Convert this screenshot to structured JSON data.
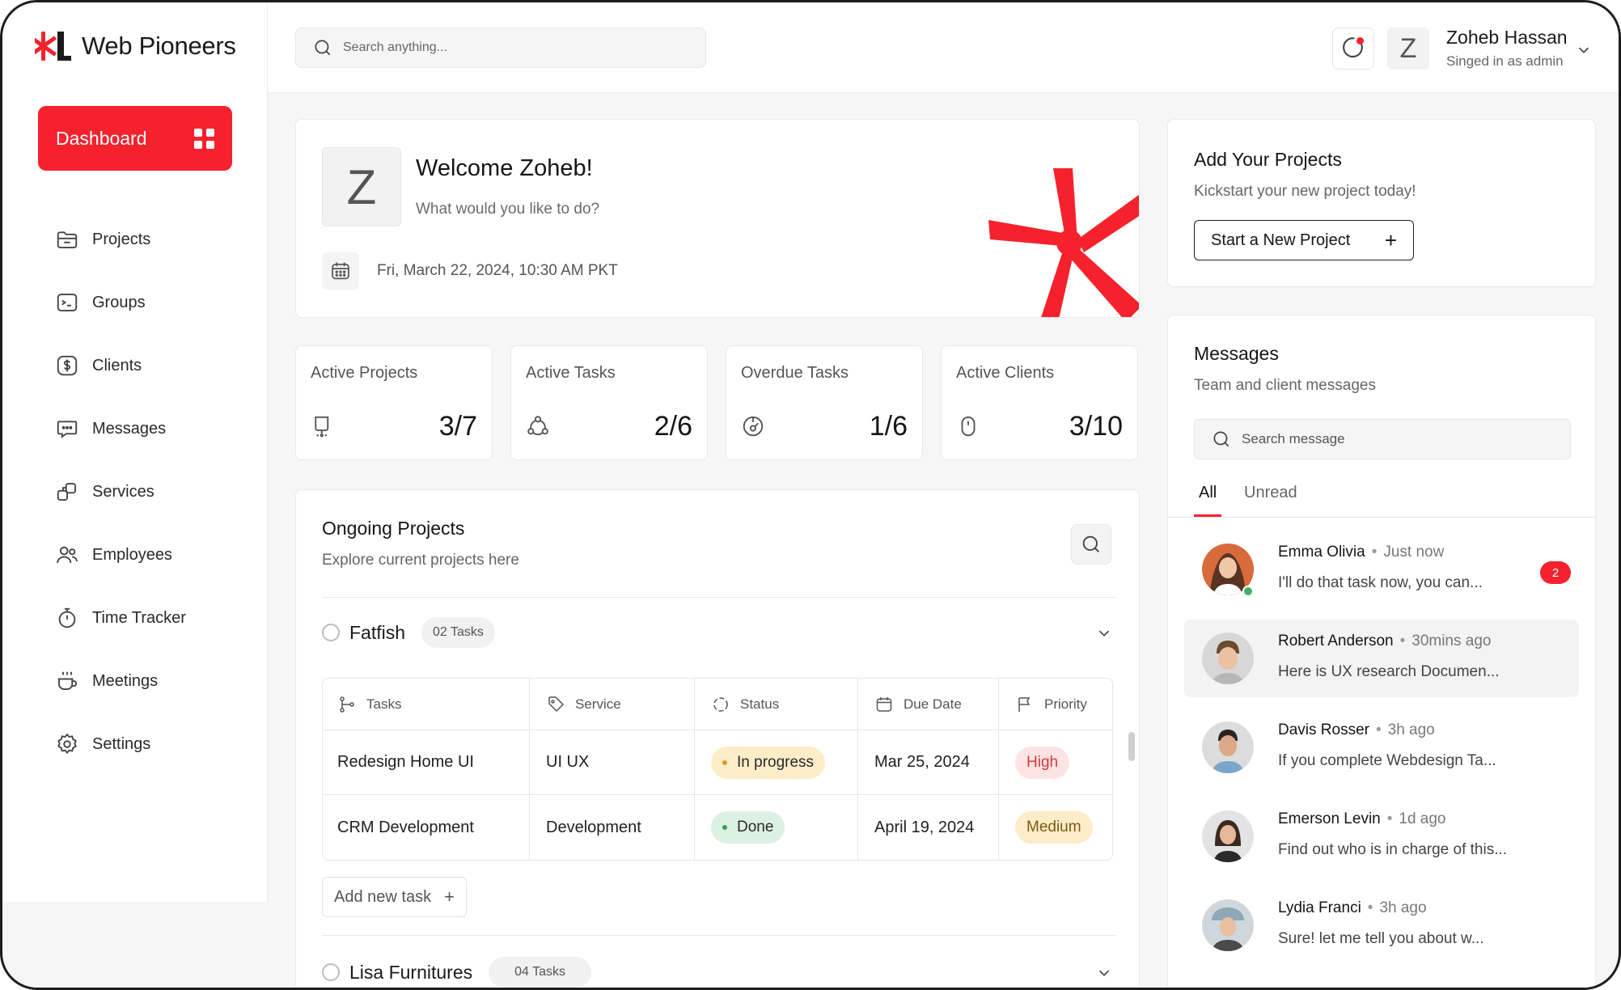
{
  "brand": {
    "name": "Web Pioneers",
    "accent": "#f5222d"
  },
  "sidebar": {
    "dashboard_label": "Dashboard",
    "items": [
      {
        "label": "Projects",
        "icon": "folder-icon"
      },
      {
        "label": "Groups",
        "icon": "terminal-icon"
      },
      {
        "label": "Clients",
        "icon": "dollar-icon"
      },
      {
        "label": "Messages",
        "icon": "chat-icon"
      },
      {
        "label": "Services",
        "icon": "services-icon"
      },
      {
        "label": "Employees",
        "icon": "users-icon"
      },
      {
        "label": "Time Tracker",
        "icon": "stopwatch-icon"
      },
      {
        "label": "Meetings",
        "icon": "coffee-icon"
      },
      {
        "label": "Settings",
        "icon": "gear-icon"
      }
    ]
  },
  "header": {
    "search_placeholder": "Search anything...",
    "avatar_letter": "Z",
    "user_name": "Zoheb Hassan",
    "user_role": "Singed in as admin"
  },
  "welcome": {
    "avatar_letter": "Z",
    "title": "Welcome Zoheb!",
    "subtitle": "What would you like to do?",
    "date": "Fri, March 22, 2024, 10:30 AM PKT"
  },
  "stats": [
    {
      "label": "Active Projects",
      "value": "3/7",
      "icon": "presentation-icon"
    },
    {
      "label": "Active Tasks",
      "value": "2/6",
      "icon": "cycle-icon"
    },
    {
      "label": "Overdue Tasks",
      "value": "1/6",
      "icon": "timer-icon"
    },
    {
      "label": "Active Clients",
      "value": "3/10",
      "icon": "mouse-icon"
    }
  ],
  "projects": {
    "title": "Ongoing Projects",
    "subtitle": "Explore current projects here",
    "list": [
      {
        "name": "Fatfish",
        "tasks": "02 Tasks"
      },
      {
        "name": "Lisa Furnitures",
        "tasks": "04 Tasks"
      }
    ],
    "columns": [
      "Tasks",
      "Service",
      "Status",
      "Due Date",
      "Priority"
    ],
    "rows": [
      {
        "task": "Redesign Home UI",
        "service": "UI UX",
        "status": "In progress",
        "due": "Mar 25, 2024",
        "priority": "High"
      },
      {
        "task": "CRM Development",
        "service": "Development",
        "status": "Done",
        "due": "April 19, 2024",
        "priority": "Medium"
      }
    ],
    "add_task_label": "Add new task"
  },
  "add_projects": {
    "title": "Add Your Projects",
    "subtitle": "Kickstart your new project today!",
    "button_label": "Start a New Project"
  },
  "messages": {
    "title": "Messages",
    "subtitle": "Team and client messages",
    "search_placeholder": "Search message",
    "tabs": [
      "All",
      "Unread"
    ],
    "items": [
      {
        "name": "Emma Olivia",
        "time": "Just now",
        "text": "I'll do that task now, you can...",
        "unread": "2"
      },
      {
        "name": "Robert Anderson",
        "time": "30mins ago",
        "text": "Here is UX research Documen..."
      },
      {
        "name": "Davis Rosser",
        "time": "3h ago",
        "text": "If you complete Webdesign Ta..."
      },
      {
        "name": "Emerson Levin",
        "time": "1d ago",
        "text": "Find out who is in charge of this..."
      },
      {
        "name": "Lydia Franci",
        "time": "3h ago",
        "text": "Sure! let me tell you about w..."
      }
    ]
  }
}
